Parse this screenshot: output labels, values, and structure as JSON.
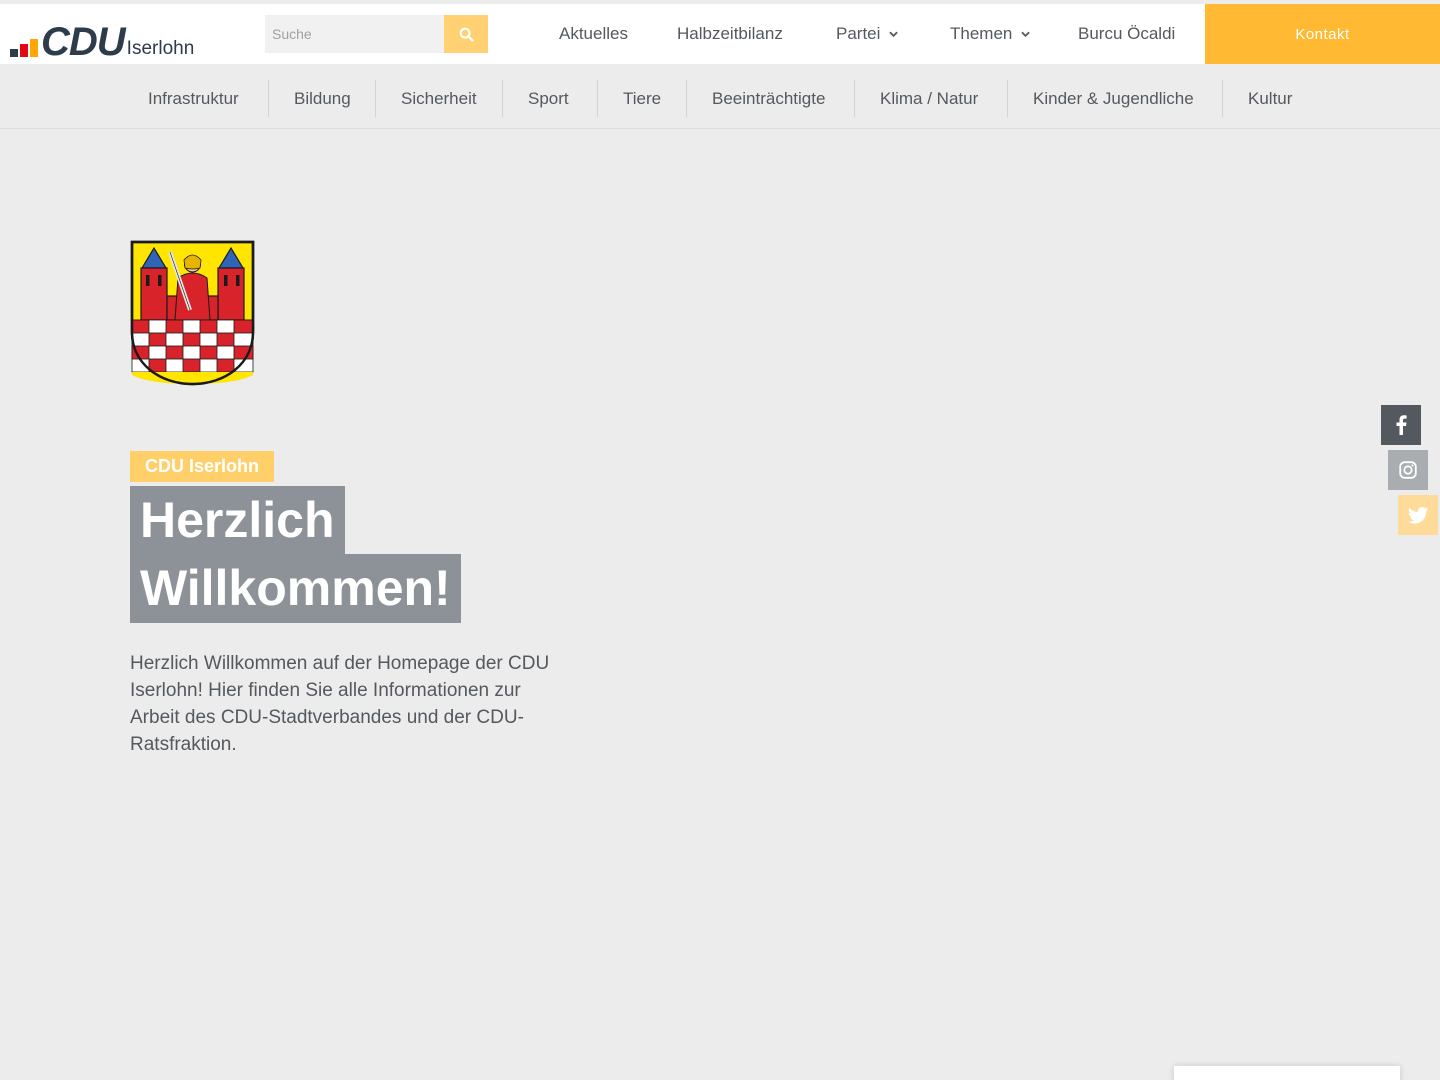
{
  "brand": {
    "logo_text": "CDU",
    "city": "Iserlohn",
    "bar_colors": [
      "#2d3c4b",
      "#e30613",
      "#ffa600"
    ]
  },
  "search": {
    "placeholder": "Suche",
    "icon": "search-icon"
  },
  "nav": {
    "items": [
      {
        "label": "Aktuelles"
      },
      {
        "label": "Halbzeitbilanz"
      },
      {
        "label": "Partei",
        "icon": "chevron-down-icon"
      },
      {
        "label": "Themen",
        "icon": "chevron-down-icon"
      },
      {
        "label": "Burcu Öcaldi"
      }
    ],
    "cta": "Kontakt"
  },
  "topics": [
    "Infrastruktur",
    "Bildung",
    "Sicherheit",
    "Sport",
    "Tiere",
    "Beeinträchtigte",
    "Klima / Natur",
    "Kinder & Jugendliche",
    "Kultur"
  ],
  "hero": {
    "badge": "CDU Iserlohn",
    "heading_line1": "Herzlich",
    "heading_line2": "Willkommen!",
    "intro": "Herzlich Willkommen auf der Homepage der CDU Iserlohn! Hier finden Sie alle Informationen zur Arbeit des CDU-Stadtverbandes und der CDU-Ratsfraktion."
  },
  "social": [
    {
      "name": "facebook-icon",
      "color": "#54595f"
    },
    {
      "name": "instagram-icon",
      "color": "#a9adb2"
    },
    {
      "name": "twitter-icon",
      "color": "#ffdb9a"
    }
  ],
  "colors": {
    "accent": "#ffb933",
    "accent_light": "#ffcf6a",
    "heading_bg": "#8c9297",
    "page_bg": "#ececec",
    "text": "#54595f"
  }
}
